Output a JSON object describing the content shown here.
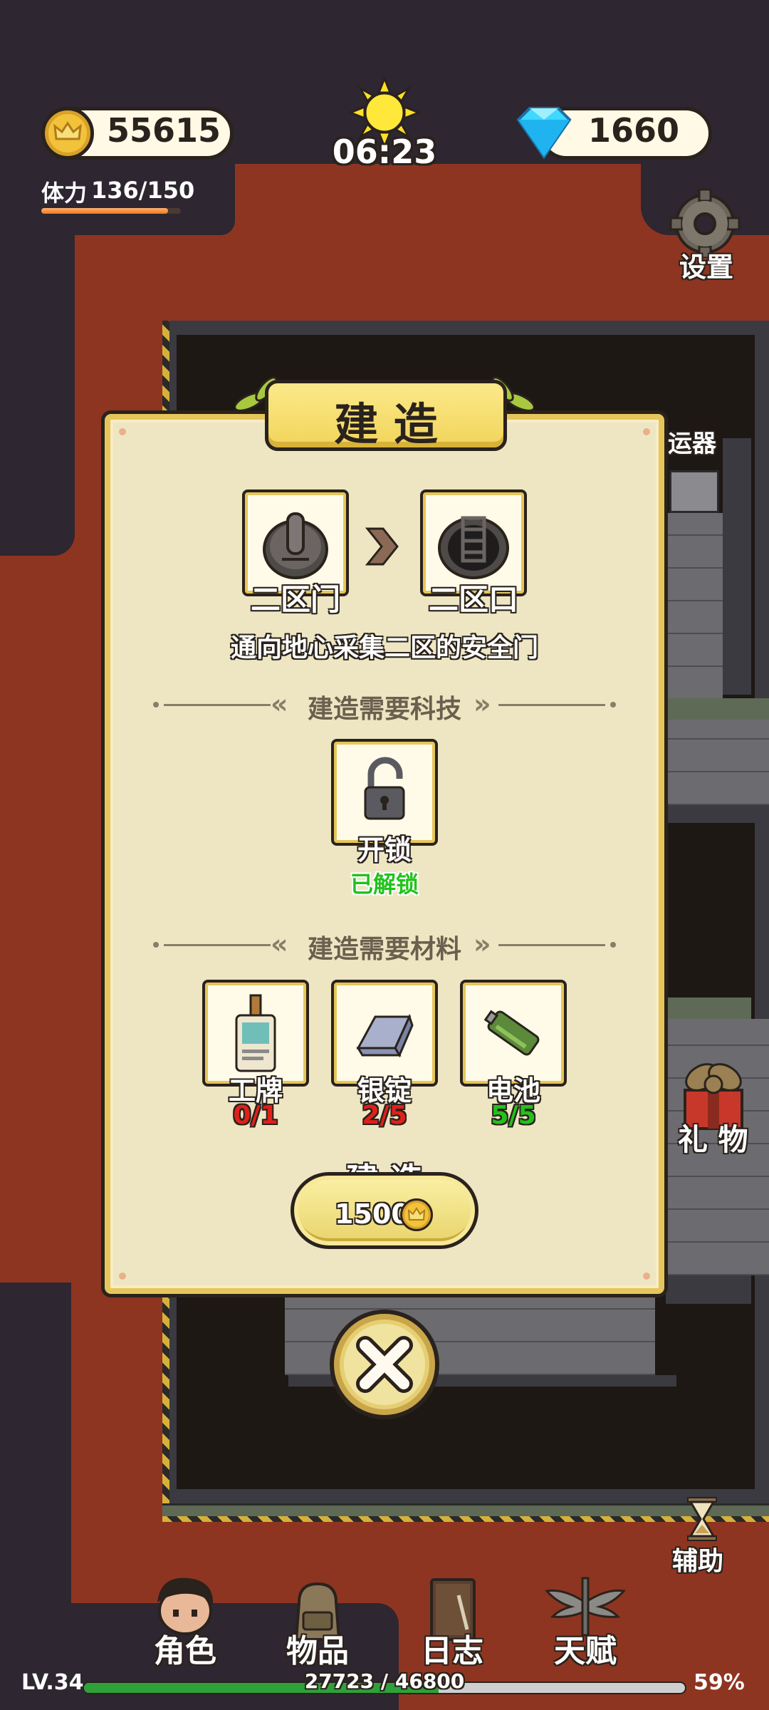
{
  "hud": {
    "gold": "55615",
    "time": "06:23",
    "diamonds": "1660",
    "stamina_label": "体力",
    "stamina_value": "136/150",
    "stamina_fraction": 0.907
  },
  "side_buttons": {
    "settings": "设置",
    "gift": "礼 物",
    "assist": "辅助",
    "partial_room_label": "运器"
  },
  "modal": {
    "title": "建 造",
    "from_name": "二区门",
    "to_name": "二区口",
    "description": "通向地心采集二区的安全门",
    "tech_header": "建造需要科技",
    "tech": {
      "name": "开锁",
      "status": "已解锁"
    },
    "materials_header": "建造需要材料",
    "materials": [
      {
        "name": "工牌",
        "count": "0/1",
        "color": "#e0201a"
      },
      {
        "name": "银锭",
        "count": "2/5",
        "color": "#e0201a"
      },
      {
        "name": "电池",
        "count": "5/5",
        "color": "#22c21c"
      }
    ],
    "build_label": "建 造",
    "build_cost": "1500"
  },
  "nav": {
    "items": [
      "角色",
      "物品",
      "日志",
      "天赋"
    ]
  },
  "footer": {
    "level": "LV.34",
    "xp": "27723 / 46800",
    "percent": "59%",
    "xp_fraction": 0.59
  },
  "colors": {
    "lava": "#8e3521",
    "panel": "#eee6c3",
    "gold": "#f2d45a",
    "unlocked_green": "#22c21c",
    "insufficient_red": "#e0201a"
  }
}
